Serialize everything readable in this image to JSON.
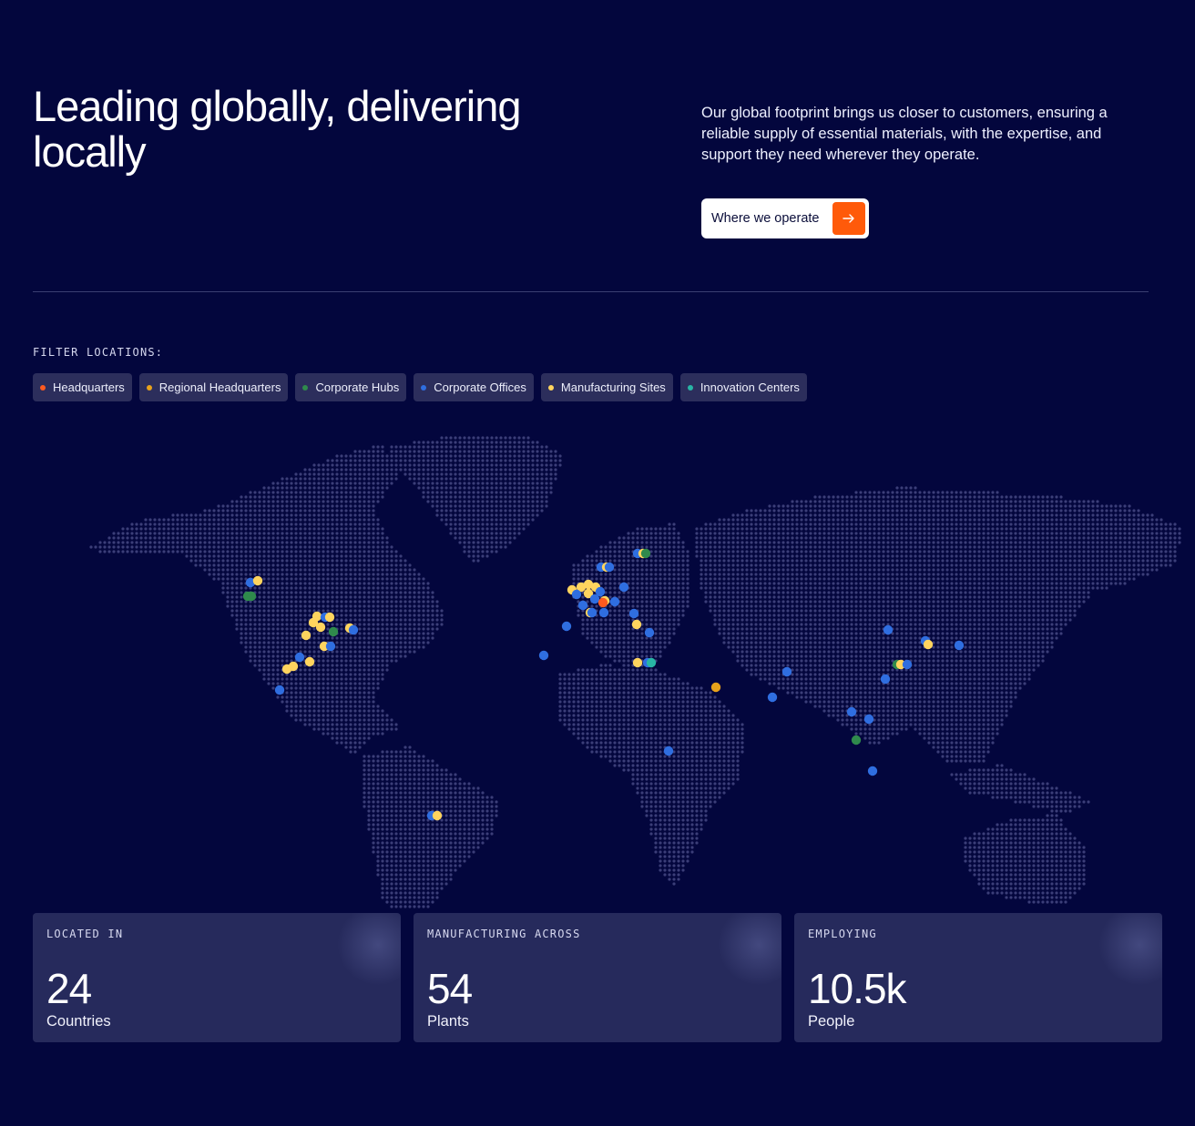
{
  "hero": {
    "headline": "Leading globally, delivering locally",
    "intro": "Our global footprint brings us closer to customers, ensuring a reliable supply of essential materials, with the expertise, and support they need wherever they operate.",
    "cta_label": "Where we operate",
    "cta_icon": "arrow-right-icon",
    "cta_color": "#ff5a0a"
  },
  "filters": {
    "title": "FILTER LOCATIONS:",
    "items": [
      {
        "label": "Headquarters",
        "color": "#ff5a1f"
      },
      {
        "label": "Regional Headquarters",
        "color": "#e8a21b"
      },
      {
        "label": "Corporate Hubs",
        "color": "#2f8a4c"
      },
      {
        "label": "Corporate Offices",
        "color": "#2f6ee0"
      },
      {
        "label": "Manufacturing Sites",
        "color": "#ffd45e"
      },
      {
        "label": "Innovation Centers",
        "color": "#28b5a5"
      }
    ]
  },
  "map": {
    "land_color": "#3b3e78",
    "background": "#03063d"
  },
  "stats": [
    {
      "label": "LOCATED IN",
      "value": "24",
      "unit": "Countries"
    },
    {
      "label": "MANUFACTURING ACROSS",
      "value": "54",
      "unit": "Plants"
    },
    {
      "label": "EMPLOYING",
      "value": "10.5k",
      "unit": "People"
    }
  ]
}
